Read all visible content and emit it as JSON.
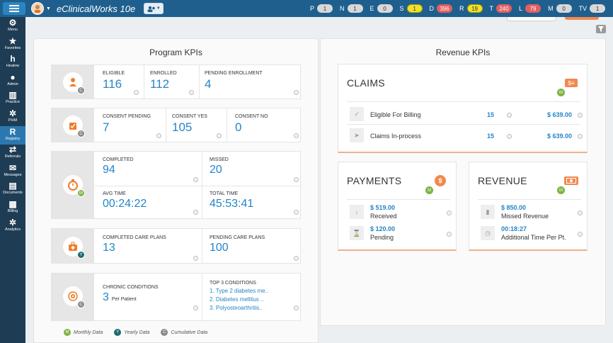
{
  "app": {
    "title": "eClinicalWorks 10e"
  },
  "counters": [
    {
      "letter": "P",
      "value": "1",
      "color": "gray"
    },
    {
      "letter": "N",
      "value": "1",
      "color": "gray"
    },
    {
      "letter": "E",
      "value": "0",
      "color": "gray"
    },
    {
      "letter": "S",
      "value": "1",
      "color": "yellow"
    },
    {
      "letter": "D",
      "value": "396",
      "color": "red"
    },
    {
      "letter": "R",
      "value": "19",
      "color": "yellow"
    },
    {
      "letter": "T",
      "value": "240",
      "color": "red"
    },
    {
      "letter": "L",
      "value": "79",
      "color": "red"
    },
    {
      "letter": "M",
      "value": "0",
      "color": "gray"
    },
    {
      "letter": "TV",
      "value": "1",
      "color": "gray"
    }
  ],
  "sidebar": {
    "items": [
      {
        "label": "Menu",
        "icon": "gear-icon"
      },
      {
        "label": "Favorites",
        "icon": "star-icon"
      },
      {
        "label": "Healow",
        "icon": "healow-icon"
      },
      {
        "label": "Admin",
        "icon": "person-icon"
      },
      {
        "label": "Practice",
        "icon": "building-icon"
      },
      {
        "label": "PHM",
        "icon": "network-icon"
      },
      {
        "label": "Registry",
        "icon": "registry-icon"
      },
      {
        "label": "Referrals",
        "icon": "arrows-icon"
      },
      {
        "label": "Messages",
        "icon": "envelope-icon"
      },
      {
        "label": "Documents",
        "icon": "document-icon"
      },
      {
        "label": "Billing",
        "icon": "billing-icon"
      },
      {
        "label": "Analytics",
        "icon": "analytics-icon"
      }
    ]
  },
  "program": {
    "title": "Program KPIs",
    "enrollment": {
      "eligible_label": "ELIGIBLE",
      "eligible": "116",
      "enrolled_label": "ENROLLED",
      "enrolled": "112",
      "pending_label": "PENDING ENROLLMENT",
      "pending": "4"
    },
    "consent": {
      "pending_label": "CONSENT PENDING",
      "pending": "7",
      "yes_label": "CONSENT YES",
      "yes": "105",
      "no_label": "CONSENT NO",
      "no": "0"
    },
    "time": {
      "completed_label": "COMPLETED",
      "completed": "94",
      "missed_label": "MISSED",
      "missed": "20",
      "avg_label": "AVG TIME",
      "avg": "00:24:22",
      "total_label": "TOTAL TIME",
      "total": "45:53:41"
    },
    "care_plans": {
      "completed_label": "COMPLETED CARE PLANS",
      "completed": "13",
      "pending_label": "PENDING CARE PLANS",
      "pending": "100"
    },
    "conditions": {
      "chronic_label": "CHRONIC CONDITIONS",
      "chronic": "3",
      "per_patient": "Per Patient",
      "top_label": "TOP 3 CONDITIONS",
      "top": [
        "1. Type 2 diabetes me..",
        "2. Diabetes mellitus ..",
        "3. Polyosteoarthritis.."
      ]
    }
  },
  "legend": {
    "monthly": "Monthly Data",
    "yearly": "Yearly Data",
    "cumulative": "Cumulative Data"
  },
  "revenue": {
    "title": "Revenue KPIs",
    "claims": {
      "title": "CLAIMS",
      "rows": [
        {
          "label": "Eligible For Billing",
          "count": "15",
          "amount": "$ 639.00"
        },
        {
          "label": "Claims In-process",
          "count": "15",
          "amount": "$ 639.00"
        }
      ]
    },
    "payments": {
      "title": "PAYMENTS",
      "rows": [
        {
          "amount": "$ 519.00",
          "label": "Received"
        },
        {
          "amount": "$ 120.00",
          "label": "Pending"
        }
      ]
    },
    "revenue": {
      "title": "REVENUE",
      "rows": [
        {
          "amount": "$ 850.00",
          "label": "Missed Revenue"
        },
        {
          "amount": "00:18:27",
          "label": "Additional Time Per Pt."
        }
      ]
    }
  },
  "colors": {
    "accent": "#2585c7",
    "topbar": "#1f5f8e",
    "sidebar": "#1e3c54",
    "orange": "#f2894e"
  }
}
